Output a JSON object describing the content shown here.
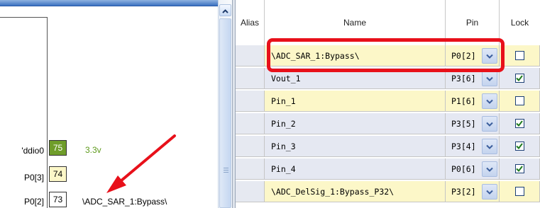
{
  "chip_view": {
    "pins": [
      {
        "name": "'ddio0",
        "number": "75",
        "label": "3.3v",
        "box_bg": "#6f9d2a",
        "num_color": "#ffffff",
        "label_color": "#5e9a1c"
      },
      {
        "name": "P0[3]",
        "number": "74",
        "label": "",
        "box_bg": "#fcf7c8",
        "num_color": "#000000",
        "label_color": "#000000"
      },
      {
        "name": "P0[2]",
        "number": "73",
        "label": "\\ADC_SAR_1:Bypass\\",
        "box_bg": "#ffffff",
        "num_color": "#000000",
        "label_color": "#000000"
      }
    ]
  },
  "table": {
    "headers": {
      "alias": "Alias",
      "name": "Name",
      "pin": "Pin",
      "lock": "Lock"
    },
    "rows": [
      {
        "alias": "",
        "name": "\\ADC_SAR_1:Bypass\\",
        "pin": "P0[2]",
        "locked": false,
        "color": "yellow"
      },
      {
        "alias": "",
        "name": "Vout_1",
        "pin": "P3[6]",
        "locked": true,
        "color": "lav"
      },
      {
        "alias": "",
        "name": "Pin_1",
        "pin": "P1[6]",
        "locked": false,
        "color": "yellow"
      },
      {
        "alias": "",
        "name": "Pin_2",
        "pin": "P3[5]",
        "locked": true,
        "color": "lav"
      },
      {
        "alias": "",
        "name": "Pin_3",
        "pin": "P3[4]",
        "locked": true,
        "color": "lav"
      },
      {
        "alias": "",
        "name": "Pin_4",
        "pin": "P0[6]",
        "locked": true,
        "color": "lav"
      },
      {
        "alias": "",
        "name": "\\ADC_DelSig_1:Bypass_P32\\",
        "pin": "P3[2]",
        "locked": false,
        "color": "yellow"
      }
    ]
  },
  "icons": {
    "scroll_up": "chevron-up-icon",
    "dropdown": "chevron-down-icon",
    "checkmark": "checkmark-icon"
  },
  "colors": {
    "annotation_red": "#e8101a",
    "row_yellow": "#fcf7c8",
    "row_lavender": "#e5e8f2",
    "pin_green": "#6f9d2a"
  }
}
